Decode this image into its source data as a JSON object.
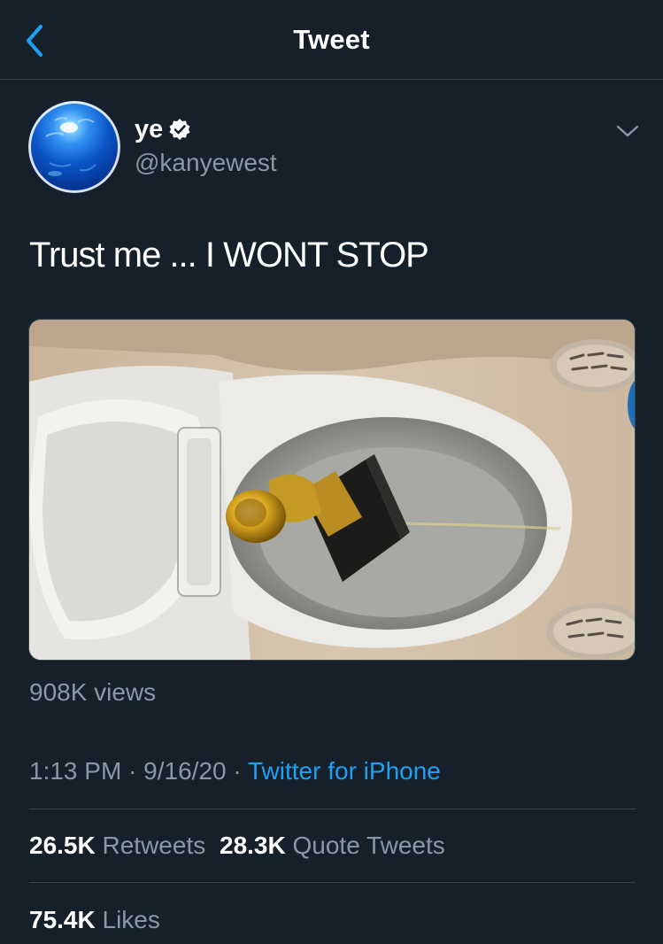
{
  "header": {
    "title": "Tweet",
    "back_icon": "chevron-left-icon"
  },
  "tweet": {
    "author": {
      "display_name": "ye",
      "handle": "@kanyewest",
      "verified": true
    },
    "text": "Trust me ... I WONT STOP",
    "media": {
      "type": "video",
      "description_icon": "video-thumbnail"
    },
    "views": "908K views",
    "time": "1:13 PM",
    "separator": "·",
    "date": "9/16/20",
    "source": "Twitter for iPhone",
    "stats": {
      "retweets_count": "26.5K",
      "retweets_label": "Retweets",
      "quotes_count": "28.3K",
      "quotes_label": "Quote Tweets",
      "likes_count": "75.4K",
      "likes_label": "Likes"
    }
  },
  "colors": {
    "background": "#15202b",
    "accent": "#1da1f2",
    "secondary_text": "#8899a6",
    "divider": "#38444d"
  }
}
